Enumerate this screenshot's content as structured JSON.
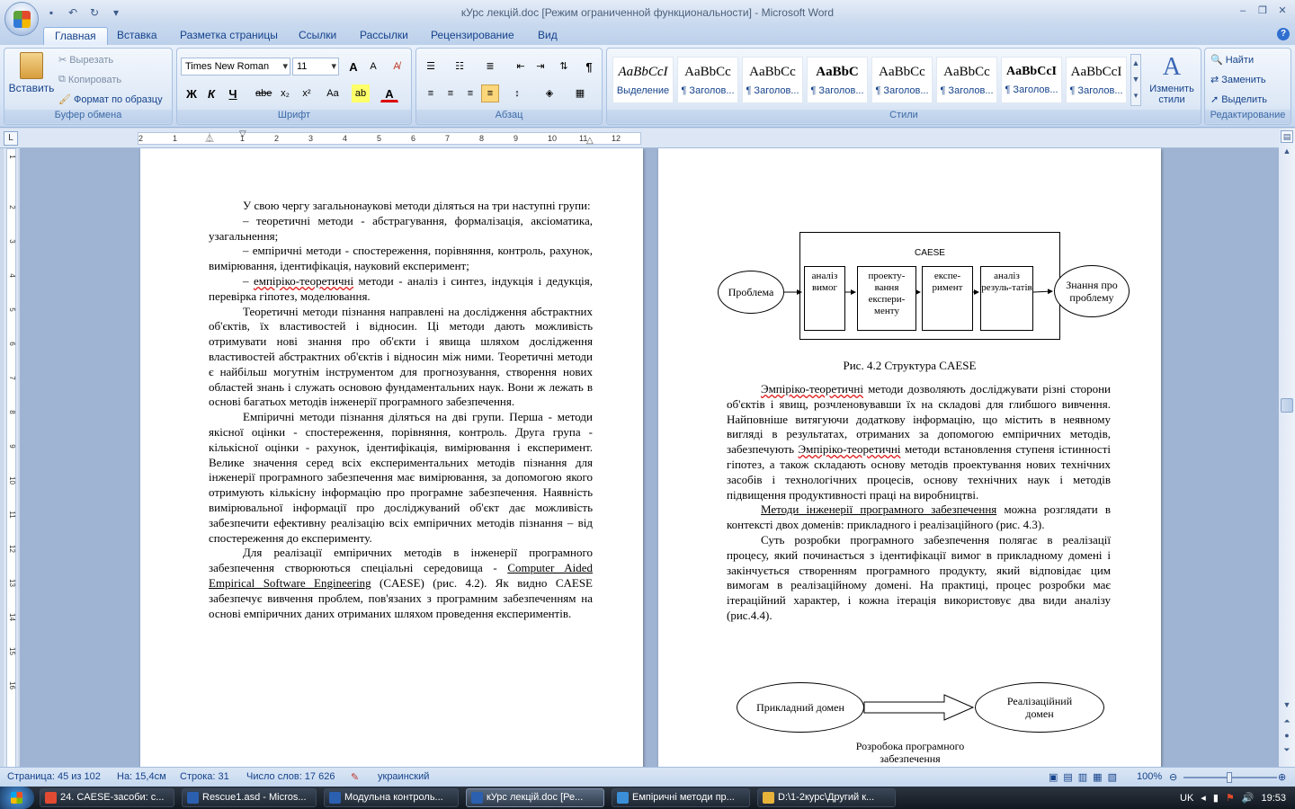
{
  "window": {
    "title": "кУрс лекцій.doc [Режим ограниченной функциональности] - Microsoft Word",
    "controls": [
      "–",
      "❐",
      "✕"
    ]
  },
  "tabs": [
    "Главная",
    "Вставка",
    "Разметка страницы",
    "Ссылки",
    "Рассылки",
    "Рецензирование",
    "Вид"
  ],
  "clipboard": {
    "paste": "Вставить",
    "cut": "Вырезать",
    "copy": "Копировать",
    "format_painter": "Формат по образцу",
    "label": "Буфер обмена"
  },
  "font": {
    "name": "Times New Roman",
    "size": "11",
    "label": "Шрифт",
    "bold": "Ж",
    "italic": "К",
    "underline": "Ч",
    "strike": "abe",
    "sub": "x₂",
    "sup": "x²",
    "case": "Aa",
    "grow": "A",
    "shrink": "A"
  },
  "paragraph": {
    "label": "Абзац",
    "pilcrow": "¶"
  },
  "styles": {
    "label": "Стили",
    "change": "Изменить стили",
    "tiles": [
      {
        "sample": "AaBbCcI",
        "name": "Выделение"
      },
      {
        "sample": "AaBbCc",
        "name": "¶ Заголов..."
      },
      {
        "sample": "AaBbCc",
        "name": "¶ Заголов..."
      },
      {
        "sample": "AaBbC",
        "name": "¶ Заголов..."
      },
      {
        "sample": "AaBbCc",
        "name": "¶ Заголов..."
      },
      {
        "sample": "AaBbCc",
        "name": "¶ Заголов..."
      },
      {
        "sample": "AaBbCcI",
        "name": "¶ Заголов..."
      },
      {
        "sample": "AaBbCcI",
        "name": "¶ Заголов..."
      }
    ]
  },
  "editing": {
    "label": "Редактирование",
    "find": "Найти",
    "replace": "Заменить",
    "select": "Выделить"
  },
  "ruler": {
    "numbers": [
      "2",
      "1",
      "1",
      "1",
      "2",
      "3",
      "4",
      "5",
      "6",
      "7",
      "8",
      "9",
      "10",
      "11",
      "12"
    ],
    "vnumbers": [
      "1",
      "1",
      "2",
      "3",
      "4",
      "5",
      "6",
      "7",
      "8",
      "9",
      "10",
      "11",
      "12",
      "13",
      "14",
      "15",
      "16"
    ]
  },
  "left_page": {
    "p1": "У свою чергу загальнонаукові методи діляться на три наступні групи:",
    "d1": "–  теоретичні методи - абстрагування, формалізація, аксіоматика, узагальнення;",
    "d2": "–  емпіричні методи - спостереження, порівняння, контроль, рахунок, вимірювання, ідентифікація, науковий експеримент;",
    "d3_a": "–  ",
    "d3_u": "емпіріко-теоретичні",
    "d3_b": " методи - аналіз і синтез, індукція і дедукція, перевірка гіпотез, моделювання.",
    "p2": "Теоретичні методи пізнання направлені на дослідження абстрактних об'єктів, їх властивостей і відносин. Ці методи дають можливість отримувати нові знання про об'єкти і явища шляхом дослідження властивостей абстрактних об'єктів і відносин між ними. Теоретичні методи є найбільш могутнім інструментом для прогнозування, створення нових областей знань і служать основою фундаментальних наук. Вони ж лежать в основі багатьох методів інженерії програмного забезпечення.",
    "p3": "Емпіричні методи пізнання діляться на дві групи. Перша - методи якісної оцінки - спостереження, порівняння, контроль. Друга група - кількісної оцінки - рахунок, ідентифікація, вимірювання і експеримент. Велике значення серед всіх експериментальних методів пізнання для інженерії програмного забезпечення має вимірювання, за допомогою якого отримують кількісну інформацію про програмне забезпечення. Наявність вимірювальної інформації про досліджуваний об'єкт дає можливість забезпечити ефективну реалізацію всіх емпіричних методів пізнання – від спостереження до експерименту.",
    "p4_a": "Для реалізації емпіричних методів в інженерії програмного забезпечення створюються спеціальні середовища - ",
    "p4_u": "Computer Aided Empirical Software Engineering",
    "p4_b": " (CAESE) (рис. 4.2). Як видно CAESE забезпечує вивчення проблем, пов'язаних з програмним забезпеченням на основі емпіричних даних отриманих шляхом проведення експериментів."
  },
  "diagram1": {
    "frame_label": "CAESE",
    "start": "Проблема",
    "end": "Знання про проблему",
    "boxes": [
      "аналіз вимог",
      "проекту-вання експери-менту",
      "експе-римент",
      "аналіз резуль-татів"
    ],
    "caption": "Рис. 4.2 Структура CAESE"
  },
  "right_page": {
    "p1_u": "Эмпіріко-теоретичні",
    "p1_a": " методи дозволяють досліджувати різні сторони об'єктів і явищ, розчленовувавши їх на складові для глибшого вивчення. Найповніше витягуючи додаткову інформацію, що містить в неявному вигляді в результатах, отриманих за допомогою емпіричних методів, забезпечують ",
    "p1_u2": "Эмпіріко-теоретичні",
    "p1_b": " методи встановлення ступеня істинності гіпотез, а також складають основу методів проектування нових технічних засобів і технологічних процесів, основу технічних наук і методів підвищення продуктивності праці на виробництві.",
    "p2_u": "Методи інженерії програмного забезпечення",
    "p2_b": " можна розглядати в контексті двох доменів: прикладного і реалізаційного (рис. 4.3).",
    "p3": "Суть розробки програмного забезпечення полягає в реалізації процесу, який починається з ідентифікації вимог в прикладному домені і закінчується створенням програмного продукту, який відповідає цим вимогам в реалізаційному домені. На практиці, процес розробки має ітераційний характер, і кожна ітерація використовує два види аналізу (рис.4.4)."
  },
  "diagram2": {
    "left": "Прикладний домен",
    "right": "Реалізаційний домен",
    "caption": "Розробока програмного забезпечення"
  },
  "status": {
    "page": "Страница: 45 из 102",
    "pos": "На: 15,4см",
    "line": "Строка: 31",
    "words": "Число слов: 17 626",
    "lang": "украинский",
    "zoom": "100%"
  },
  "taskbar": {
    "items": [
      {
        "label": "24. CAESE-засоби: с...",
        "color": "#e24a32"
      },
      {
        "label": "Rescue1.asd - Micros...",
        "color": "#2b5fb0"
      },
      {
        "label": "Модульна контроль...",
        "color": "#2b5fb0"
      },
      {
        "label": "кУрс лекцій.doc [Ре...",
        "color": "#2b5fb0"
      },
      {
        "label": "Емпіричні методи пр...",
        "color": "#3a8fd8"
      },
      {
        "label": "D:\\1-2курс\\Другий к...",
        "color": "#e8b339"
      }
    ],
    "lang": "UK",
    "clock": "19:53"
  }
}
